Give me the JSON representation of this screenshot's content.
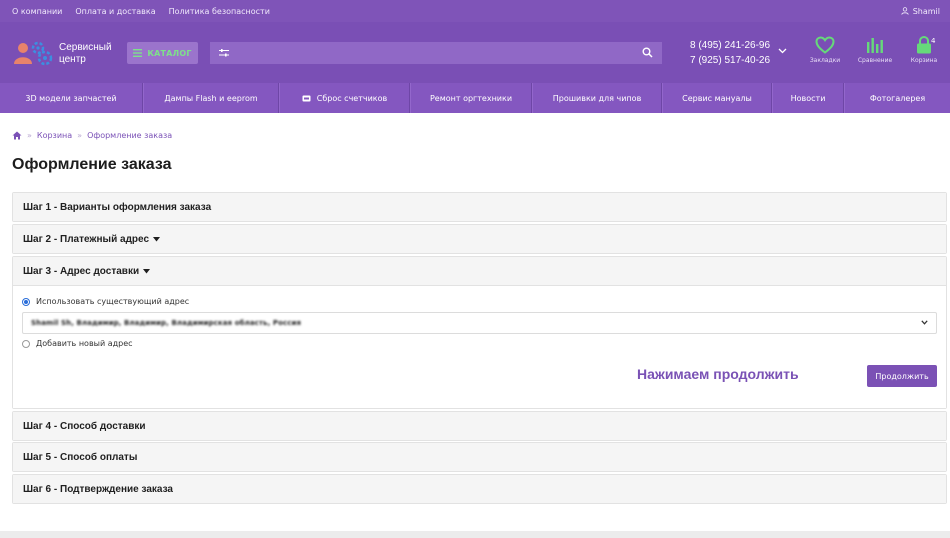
{
  "topbar": {
    "links": [
      "О компании",
      "Оплата и доставка",
      "Политика безопасности"
    ],
    "user": "Shamil"
  },
  "header": {
    "logo_line1": "Сервисный",
    "logo_line2": "центр",
    "catalog_label": "КАТАЛОГ",
    "search_value": "",
    "phones": [
      "8 (495) 241-26-96",
      "7 (925) 517-40-26"
    ],
    "bookmarks_label": "Закладки",
    "compare_label": "Сравнение",
    "cart_label": "Корзина",
    "cart_count": "4"
  },
  "nav": {
    "items": [
      "3D модели запчастей",
      "Дампы Flash и eeprom",
      "Сброс счетчиков",
      "Ремонт оргтехники",
      "Прошивки для чипов",
      "Сервис мануалы",
      "Новости",
      "Фотогалерея"
    ]
  },
  "breadcrumb": {
    "items": [
      "Корзина",
      "Оформление заказа"
    ]
  },
  "page": {
    "title": "Оформление заказа"
  },
  "steps": [
    {
      "label": "Шаг 1 - Варианты оформления заказа"
    },
    {
      "label": "Шаг 2 - Платежный адрес"
    },
    {
      "label": "Шаг 3 - Адрес доставки"
    },
    {
      "label": "Шаг 4 - Способ доставки"
    },
    {
      "label": "Шаг 5 - Способ оплаты"
    },
    {
      "label": "Шаг 6 - Подтверждение заказа"
    }
  ],
  "shipping": {
    "use_existing_label": "Использовать существующий адрес",
    "selected_address": "Shamil Sh, Владимир, Владимир, Владимирская область, Россия",
    "add_new_label": "Добавить новый адрес",
    "hint": "Нажимаем продолжить",
    "continue_label": "Продолжить"
  },
  "colors": {
    "brand": "#7a4fb5",
    "accent_green": "#7ee08a",
    "radio_blue": "#2a6ed9"
  },
  "icons": {
    "user": "user-icon",
    "catalog": "menu-icon",
    "filter": "sliders-icon",
    "search": "search-icon",
    "chevron": "chevron-down-icon",
    "bookmarks": "heart-icon",
    "compare": "bar-chart-icon",
    "cart": "lock-bag-icon",
    "home": "home-icon",
    "counter": "printer-cartridge-icon"
  }
}
